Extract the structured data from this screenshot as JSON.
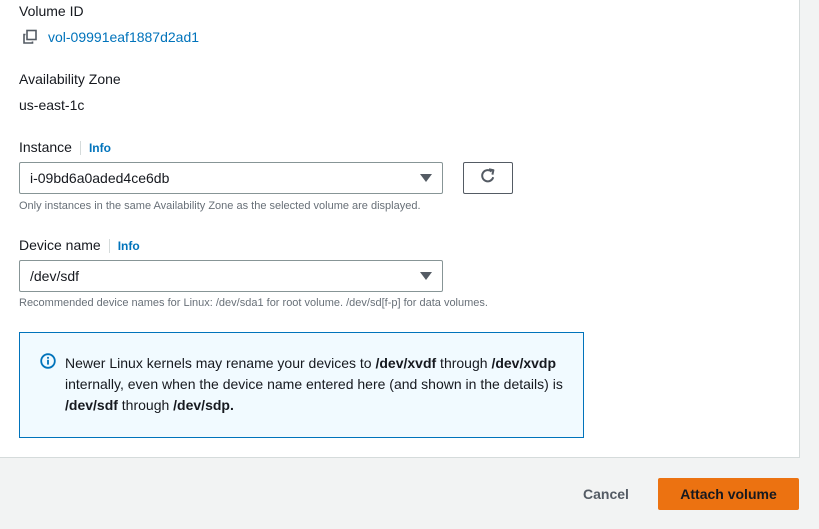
{
  "volume_id": {
    "label": "Volume ID",
    "value": "vol-09991eaf1887d2ad1",
    "icon": "copy-icon"
  },
  "availability_zone": {
    "label": "Availability Zone",
    "value": "us-east-1c"
  },
  "instance": {
    "label": "Instance",
    "info": "Info",
    "selected": "i-09bd6a0aded4ce6db",
    "hint": "Only instances in the same Availability Zone as the selected volume are displayed.",
    "refresh_icon": "refresh-icon"
  },
  "device_name": {
    "label": "Device name",
    "info": "Info",
    "value": "/dev/sdf",
    "hint": "Recommended device names for Linux: /dev/sda1 for root volume. /dev/sd[f-p] for data volumes."
  },
  "alert": {
    "icon": "info-circle-icon",
    "t1": "Newer Linux kernels may rename your devices to ",
    "b1": "/dev/xvdf",
    "t2": " through ",
    "b2": "/dev/xvdp",
    "t3": " internally, even when the device name entered here (and shown in the details) is ",
    "b3": "/dev/sdf",
    "t4": " through ",
    "b4": "/dev/sdp."
  },
  "footer": {
    "cancel_label": "Cancel",
    "attach_label": "Attach volume"
  },
  "colors": {
    "link": "#0073bb",
    "primary_button": "#ec7211",
    "alert_border": "#0073bb",
    "alert_background": "#f1faff"
  }
}
